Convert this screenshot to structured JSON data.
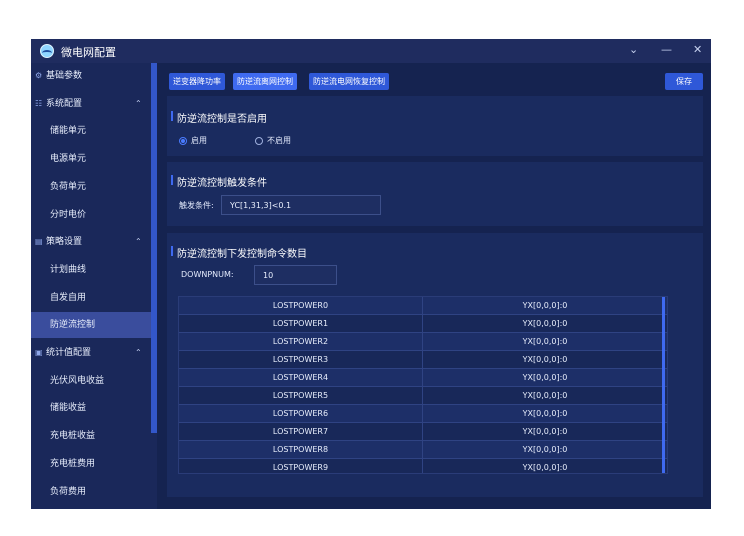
{
  "app": {
    "title": "微电网配置"
  },
  "window_controls": {
    "chevron": "⌄",
    "minimize": "—",
    "close": "✕"
  },
  "sidebar": {
    "items": [
      {
        "type": "group",
        "icon": "⚙",
        "label": "基础参数"
      },
      {
        "type": "group",
        "icon": "☷",
        "label": "系统配置",
        "chev": "⌃"
      },
      {
        "type": "sub",
        "label": "储能单元"
      },
      {
        "type": "sub",
        "label": "电源单元"
      },
      {
        "type": "sub",
        "label": "负荷单元"
      },
      {
        "type": "sub",
        "label": "分时电价"
      },
      {
        "type": "group",
        "icon": "▤",
        "label": "策略设置",
        "chev": "⌃"
      },
      {
        "type": "sub",
        "label": "计划曲线"
      },
      {
        "type": "sub",
        "label": "自发自用"
      },
      {
        "type": "sub",
        "label": "防逆流控制",
        "active": true
      },
      {
        "type": "group",
        "icon": "▣",
        "label": "统计值配置",
        "chev": "⌃"
      },
      {
        "type": "sub",
        "label": "光伏风电收益"
      },
      {
        "type": "sub",
        "label": "储能收益"
      },
      {
        "type": "sub",
        "label": "充电桩收益"
      },
      {
        "type": "sub",
        "label": "充电桩费用"
      },
      {
        "type": "sub",
        "label": "负荷费用"
      }
    ]
  },
  "toolbar": {
    "tabs": [
      "逆变器降功率",
      "防逆流离网控制",
      "防逆流电网恢复控制"
    ],
    "save_label": "保存"
  },
  "enable_panel": {
    "title": "防逆流控制是否启用",
    "options": [
      "启用",
      "不启用"
    ],
    "selected": "启用"
  },
  "trigger_panel": {
    "title": "防逆流控制触发条件",
    "field_label": "触发条件:",
    "field_value": "YC[1,31,3]<0.1"
  },
  "command_panel": {
    "title": "防逆流控制下发控制命令数目",
    "field_label": "DOWNPNUM:",
    "field_value": "10",
    "rows": [
      [
        "LOSTPOWER0",
        "YX[0,0,0]:0"
      ],
      [
        "LOSTPOWER1",
        "YX[0,0,0]:0"
      ],
      [
        "LOSTPOWER2",
        "YX[0,0,0]:0"
      ],
      [
        "LOSTPOWER3",
        "YX[0,0,0]:0"
      ],
      [
        "LOSTPOWER4",
        "YX[0,0,0]:0"
      ],
      [
        "LOSTPOWER5",
        "YX[0,0,0]:0"
      ],
      [
        "LOSTPOWER6",
        "YX[0,0,0]:0"
      ],
      [
        "LOSTPOWER7",
        "YX[0,0,0]:0"
      ],
      [
        "LOSTPOWER8",
        "YX[0,0,0]:0"
      ],
      [
        "LOSTPOWER9",
        "YX[0,0,0]:0"
      ]
    ]
  }
}
